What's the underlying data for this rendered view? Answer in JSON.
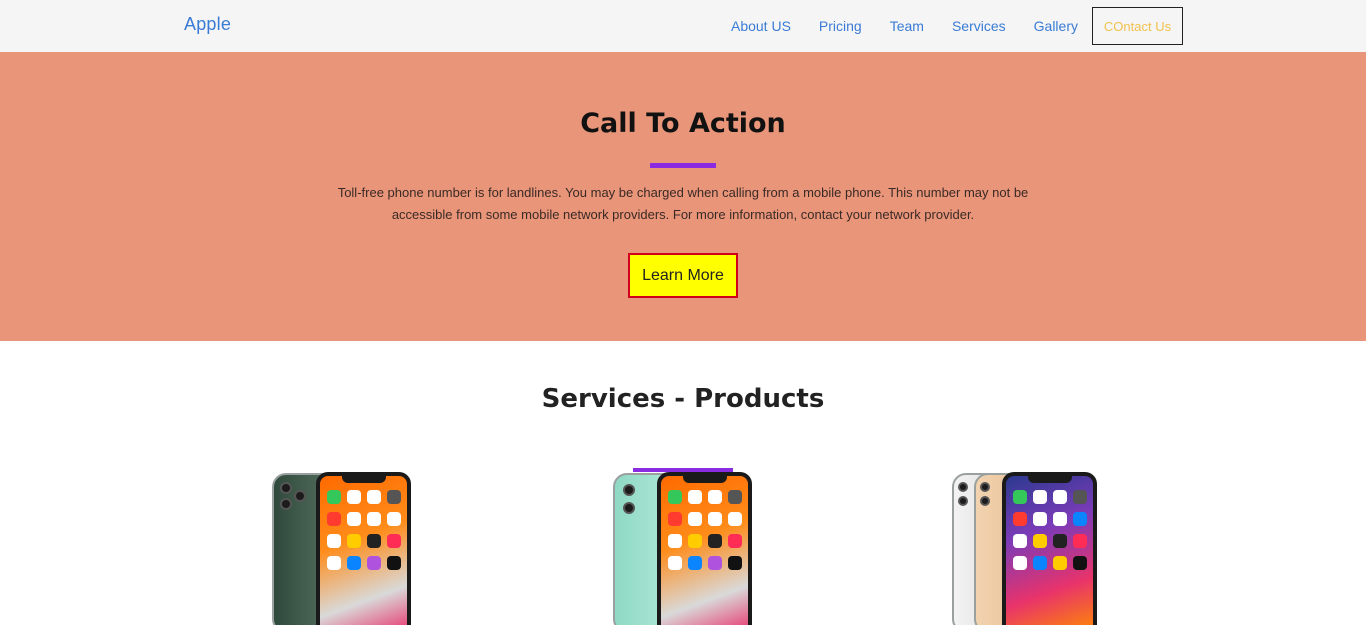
{
  "navbar": {
    "brand": "Apple",
    "links": [
      "About US",
      "Pricing",
      "Team",
      "Services",
      "Gallery"
    ],
    "contact": "COntact Us"
  },
  "cta": {
    "title": "Call To Action",
    "text": "Toll-free phone number is for landlines. You may be charged when calling from a mobile phone. This number may not be accessible from some mobile network providers. For more information, contact your network provider.",
    "button": "Learn More"
  },
  "services": {
    "title": "Services - Products"
  },
  "colors": {
    "brand_blue": "#3a7bd5",
    "cta_bg": "#e99579",
    "accent_purple": "#8a2be2",
    "button_yellow": "#ffff00",
    "button_border": "#d0021b",
    "contact_text": "#f2c14e"
  }
}
